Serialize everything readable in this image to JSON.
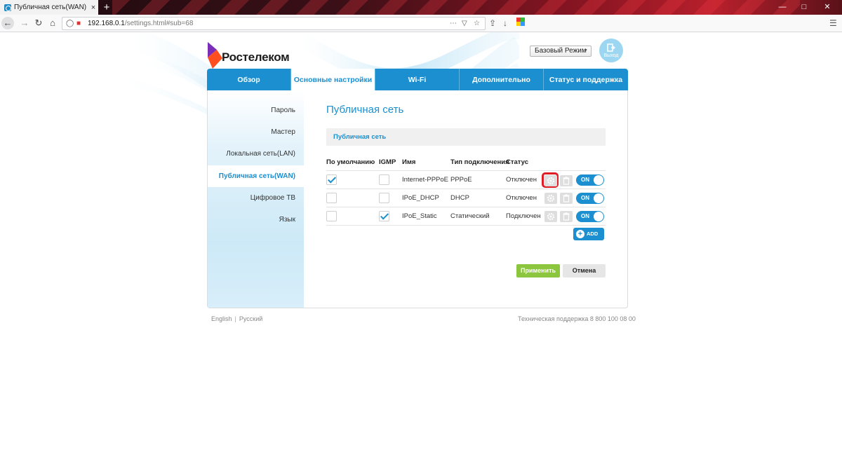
{
  "browser": {
    "tab_title": "Публичная сеть(WAN)",
    "url_host": "192.168.0.1",
    "url_path": "/settings.html#sub=68",
    "new_tab": "+",
    "close_tab": "×"
  },
  "header": {
    "logo_text": "Ростелеком",
    "mode_select_value": "Базовый Режим",
    "logout_label": "Выход"
  },
  "main_nav": [
    {
      "label": "Обзор",
      "active": false
    },
    {
      "label": "Основные настройки",
      "active": true
    },
    {
      "label": "Wi-Fi",
      "active": false
    },
    {
      "label": "Дополнительно",
      "active": false
    },
    {
      "label": "Статус и поддержка",
      "active": false
    }
  ],
  "sidebar": [
    {
      "label": "Пароль"
    },
    {
      "label": "Мастер"
    },
    {
      "label": "Локальная сеть(LAN)"
    },
    {
      "label": "Публичная сеть(WAN)",
      "active": true
    },
    {
      "label": "Цифровое ТВ"
    },
    {
      "label": "Язык"
    }
  ],
  "content": {
    "title": "Публичная сеть",
    "section": "Публичная сеть",
    "columns": [
      "По умолчанию",
      "IGMP",
      "Имя",
      "Тип подключения",
      "Статус"
    ],
    "rows": [
      {
        "default": true,
        "igmp": false,
        "name": "Internet-PPPoE",
        "type": "PPPoE",
        "status": "Отключен",
        "toggle": "ON"
      },
      {
        "default": false,
        "igmp": false,
        "name": "IPoE_DHCP",
        "type": "DHCP",
        "status": "Отключен",
        "toggle": "ON"
      },
      {
        "default": false,
        "igmp": true,
        "name": "IPoE_Static",
        "type": "Статический",
        "status": "Подключен",
        "toggle": "ON"
      }
    ],
    "add_label": "ADD",
    "apply_label": "Применить",
    "cancel_label": "Отмена"
  },
  "footer": {
    "lang_en": "English",
    "lang_sep": "|",
    "lang_ru": "Русский",
    "support": "Техническая поддержка 8 800 100 08 00"
  },
  "colors": {
    "accent": "#1b8fcf",
    "apply": "#8cc63f",
    "highlight": "#e01c24"
  }
}
